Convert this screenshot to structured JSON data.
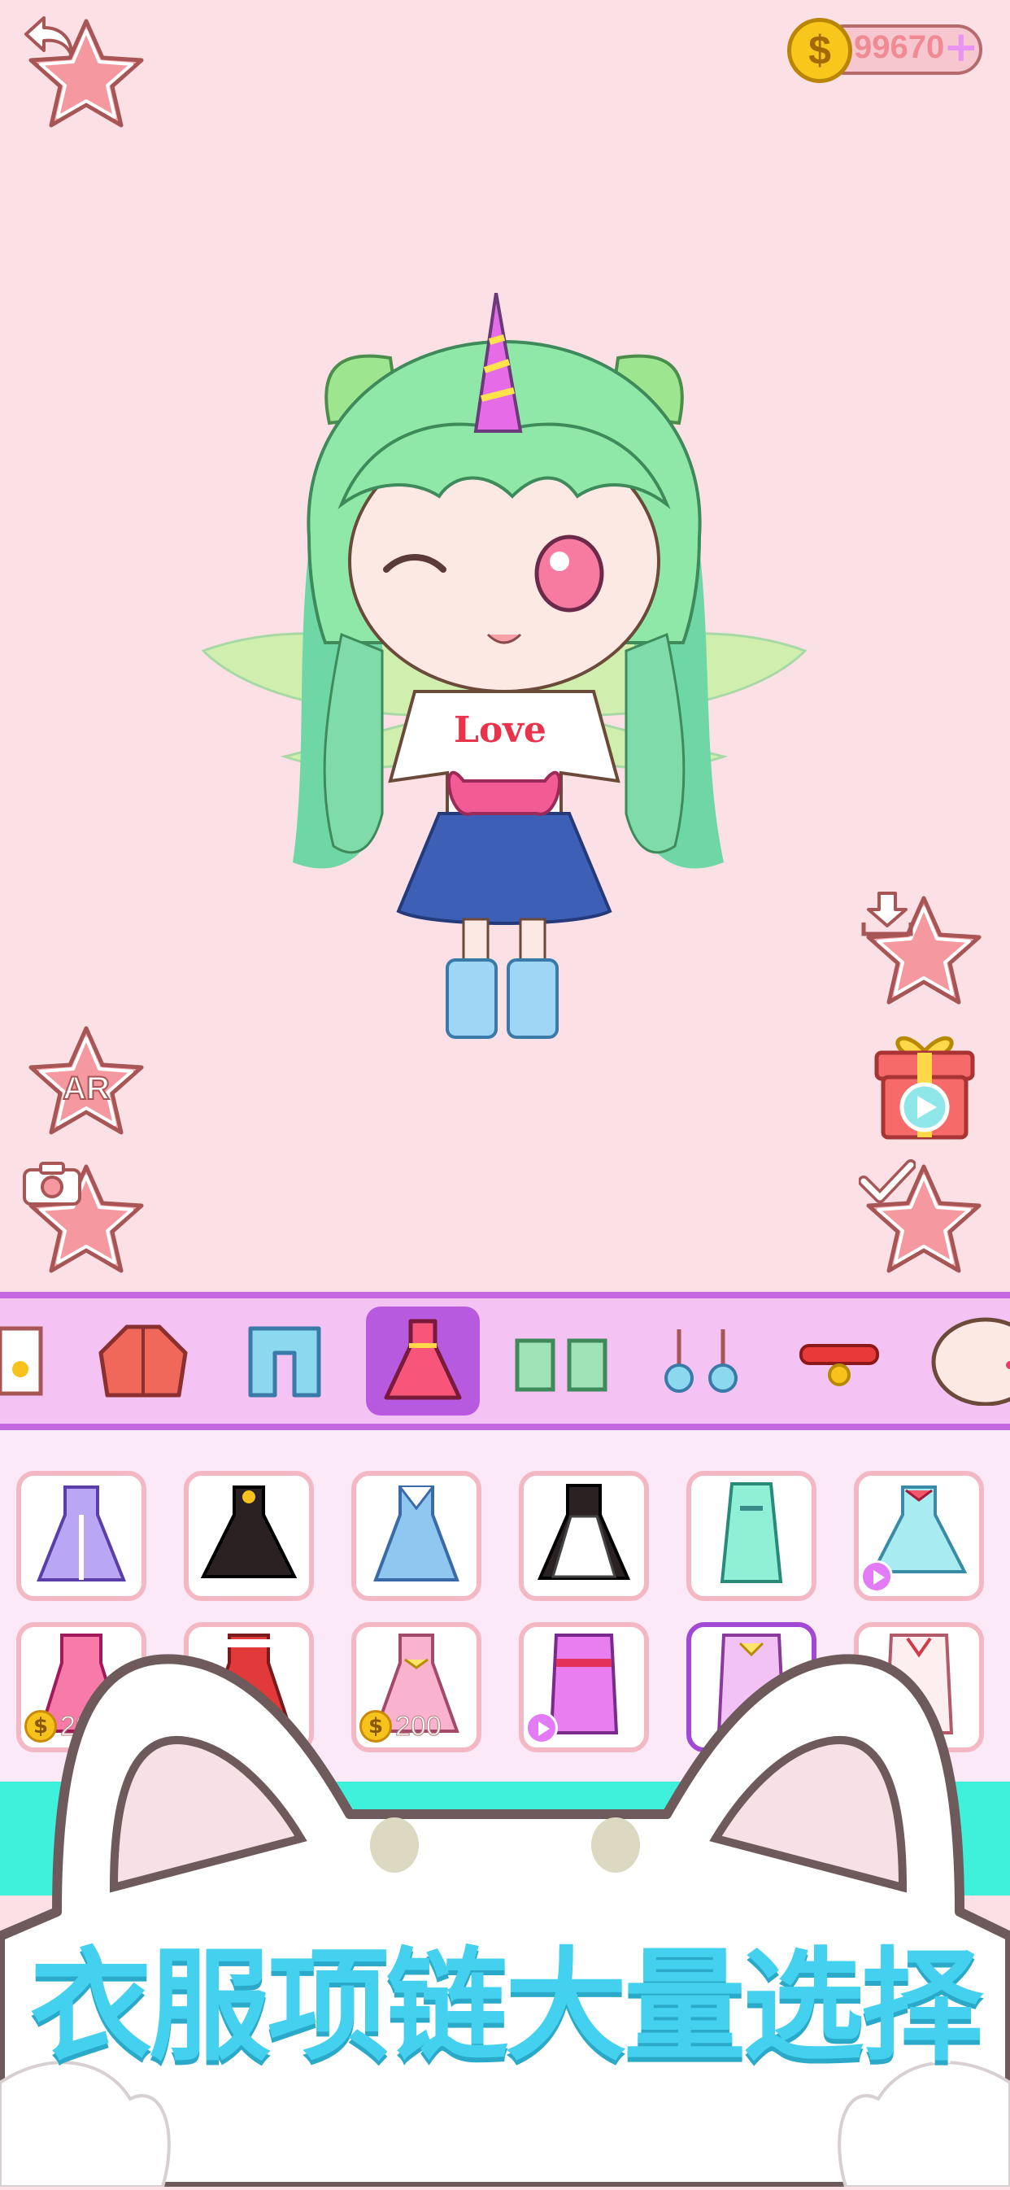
{
  "header": {
    "back_icon": "back-arrow-icon",
    "coins": "99670",
    "coin_symbol": "$",
    "add_symbol": "+"
  },
  "side_buttons": {
    "ar_label": "AR",
    "download_icon": "download-icon",
    "gift_video_icon": "gift-video-icon",
    "confirm_icon": "checkmark-icon",
    "camera_icon": "camera-icon"
  },
  "character": {
    "shirt_text": "Love"
  },
  "category_tabs": [
    {
      "name": "top",
      "active": false
    },
    {
      "name": "jacket",
      "active": false
    },
    {
      "name": "pants",
      "active": false
    },
    {
      "name": "dress",
      "active": true
    },
    {
      "name": "shoes",
      "active": false
    },
    {
      "name": "earrings",
      "active": false
    },
    {
      "name": "necklace",
      "active": false
    },
    {
      "name": "face",
      "active": false
    }
  ],
  "items": {
    "row1": [
      {
        "name": "purple-dress"
      },
      {
        "name": "black-dress"
      },
      {
        "name": "sailor-dress"
      },
      {
        "name": "maid-dress"
      },
      {
        "name": "mint-hanfu"
      },
      {
        "name": "watermelon-dress",
        "badge": "video"
      }
    ],
    "row2": [
      {
        "name": "pink-ruffle-dress",
        "price": "20"
      },
      {
        "name": "christmas-dress"
      },
      {
        "name": "pink-bow-dress",
        "price": "200"
      },
      {
        "name": "pink-kimono",
        "badge": "video"
      },
      {
        "name": "lilac-kimono",
        "selected": true
      },
      {
        "name": "white-kimono"
      }
    ]
  },
  "banner": {
    "text": "衣服项链大量选择"
  },
  "colors": {
    "background": "#fbe0e6",
    "tab_bar": "#f4c3f4",
    "tab_active": "#b75ae0",
    "banner_text": "#44d0ef",
    "star_button": "#f7a7ae"
  }
}
